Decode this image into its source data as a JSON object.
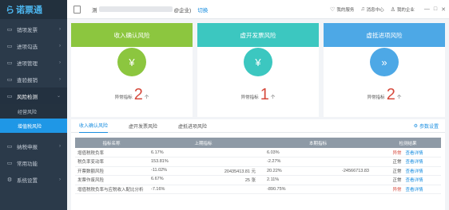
{
  "brand": {
    "name": "诺票通",
    "mark": "ら"
  },
  "sidebar": {
    "items": [
      {
        "label": "销项发票",
        "icon": "▭",
        "chev": "›"
      },
      {
        "label": "进项勾选",
        "icon": "▭",
        "chev": "›"
      },
      {
        "label": "进项管理",
        "icon": "▭",
        "chev": "›"
      },
      {
        "label": "查验报销",
        "icon": "▭",
        "chev": "›"
      },
      {
        "label": "风险检测",
        "icon": "▭",
        "chev": "⌄"
      },
      {
        "label": "纳税申报",
        "icon": "▭",
        "chev": "›"
      },
      {
        "label": "常用功能",
        "icon": "▭",
        "chev": ""
      },
      {
        "label": "系统设置",
        "icon": "⚙",
        "chev": "›"
      }
    ],
    "sub": [
      {
        "label": "经营风险"
      },
      {
        "label": "增值税风险"
      }
    ]
  },
  "topbar": {
    "company_prefix": "测",
    "company_suffix": "@企业)",
    "switch_label": "切换",
    "help": "我的服务",
    "messages": "消息中心",
    "profile": "我的企业",
    "win_min": "—",
    "win_max": "□",
    "win_close": "✕"
  },
  "cards": [
    {
      "title": "收入确认风险",
      "count_label": "异常指标",
      "count": "2",
      "unit": "个",
      "icon": "¥",
      "color": "#8cc63f"
    },
    {
      "title": "虚开发票风险",
      "count_label": "异常指标",
      "count": "1",
      "unit": "个",
      "icon": "¥",
      "color": "#3cc7c0"
    },
    {
      "title": "虚抵进项风险",
      "count_label": "异常指标",
      "count": "2",
      "unit": "个",
      "icon": "»",
      "color": "#4da8e6"
    }
  ],
  "tabs": [
    {
      "label": "收入确认风险"
    },
    {
      "label": "虚开发票风险"
    },
    {
      "label": "虚抵进项风险"
    }
  ],
  "settings_label": "参数设置",
  "table": {
    "headers": [
      "指标名称",
      "上期指标",
      "本期指标",
      "检测结果"
    ],
    "rows": [
      {
        "name": "增值税税负率",
        "prev": "6.17%",
        "prev2": "",
        "cur": "6.03%",
        "cur2": "",
        "status": "异常",
        "detail": "查看详情"
      },
      {
        "name": "税负率变动率",
        "prev": "153.81%",
        "prev2": "",
        "cur": "-2.27%",
        "cur2": "",
        "status": "正常",
        "detail": "查看详情"
      },
      {
        "name": "开票数额风险",
        "prev": "-11.02%",
        "prev2": "20435413.81 元",
        "cur": "20.22%",
        "cur2": "-24566713.83",
        "status": "正常",
        "detail": "查看详情"
      },
      {
        "name": "发票作废风险",
        "prev": "6.67%",
        "prev2": "25 张",
        "cur": "2.11%",
        "cur2": "",
        "status": "正常",
        "detail": "查看详情"
      },
      {
        "name": "增值税税负率与应税收入配比分析",
        "prev": "-7.16%",
        "prev2": "",
        "cur": "-890.75%",
        "cur2": "",
        "status": "异常",
        "detail": "查看详情"
      }
    ]
  }
}
